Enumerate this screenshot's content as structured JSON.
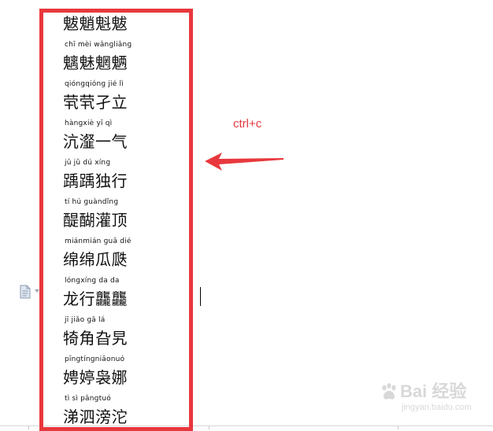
{
  "entries": [
    {
      "pinyin": "",
      "hanzi": "魃魈魁魃"
    },
    {
      "pinyin": "chī mèi wǎnɡliǎnɡ",
      "hanzi": "魑魅魍魉"
    },
    {
      "pinyin": "qiónɡqiónɡ jié lì",
      "hanzi": "茕茕孑立"
    },
    {
      "pinyin": "hànɡxiè yī qì",
      "hanzi": "沆瀣一气"
    },
    {
      "pinyin": "jǔ jǔ dú xínɡ",
      "hanzi": "踽踽独行"
    },
    {
      "pinyin": "tí hú ɡuàndǐnɡ",
      "hanzi": "醍醐灌顶"
    },
    {
      "pinyin": "miánmián ɡuā dié",
      "hanzi": "绵绵瓜瓞"
    },
    {
      "pinyin": "lónɡxínɡ da da",
      "hanzi": "龙行龘龘"
    },
    {
      "pinyin": "jī jiǎo ɡā lá",
      "hanzi": "犄角旮旯"
    },
    {
      "pinyin": "pīnɡtínɡniǎonuó",
      "hanzi": "娉婷袅娜"
    },
    {
      "pinyin": "tì sì pānɡtuó",
      "hanzi": "涕泗滂沱"
    }
  ],
  "annotation": {
    "label": "ctrl+c"
  },
  "watermark": {
    "text": "Bai 经验",
    "sub": "jingyan.baidu.com"
  },
  "colors": {
    "highlight": "#e8383d",
    "text": "#111111"
  }
}
